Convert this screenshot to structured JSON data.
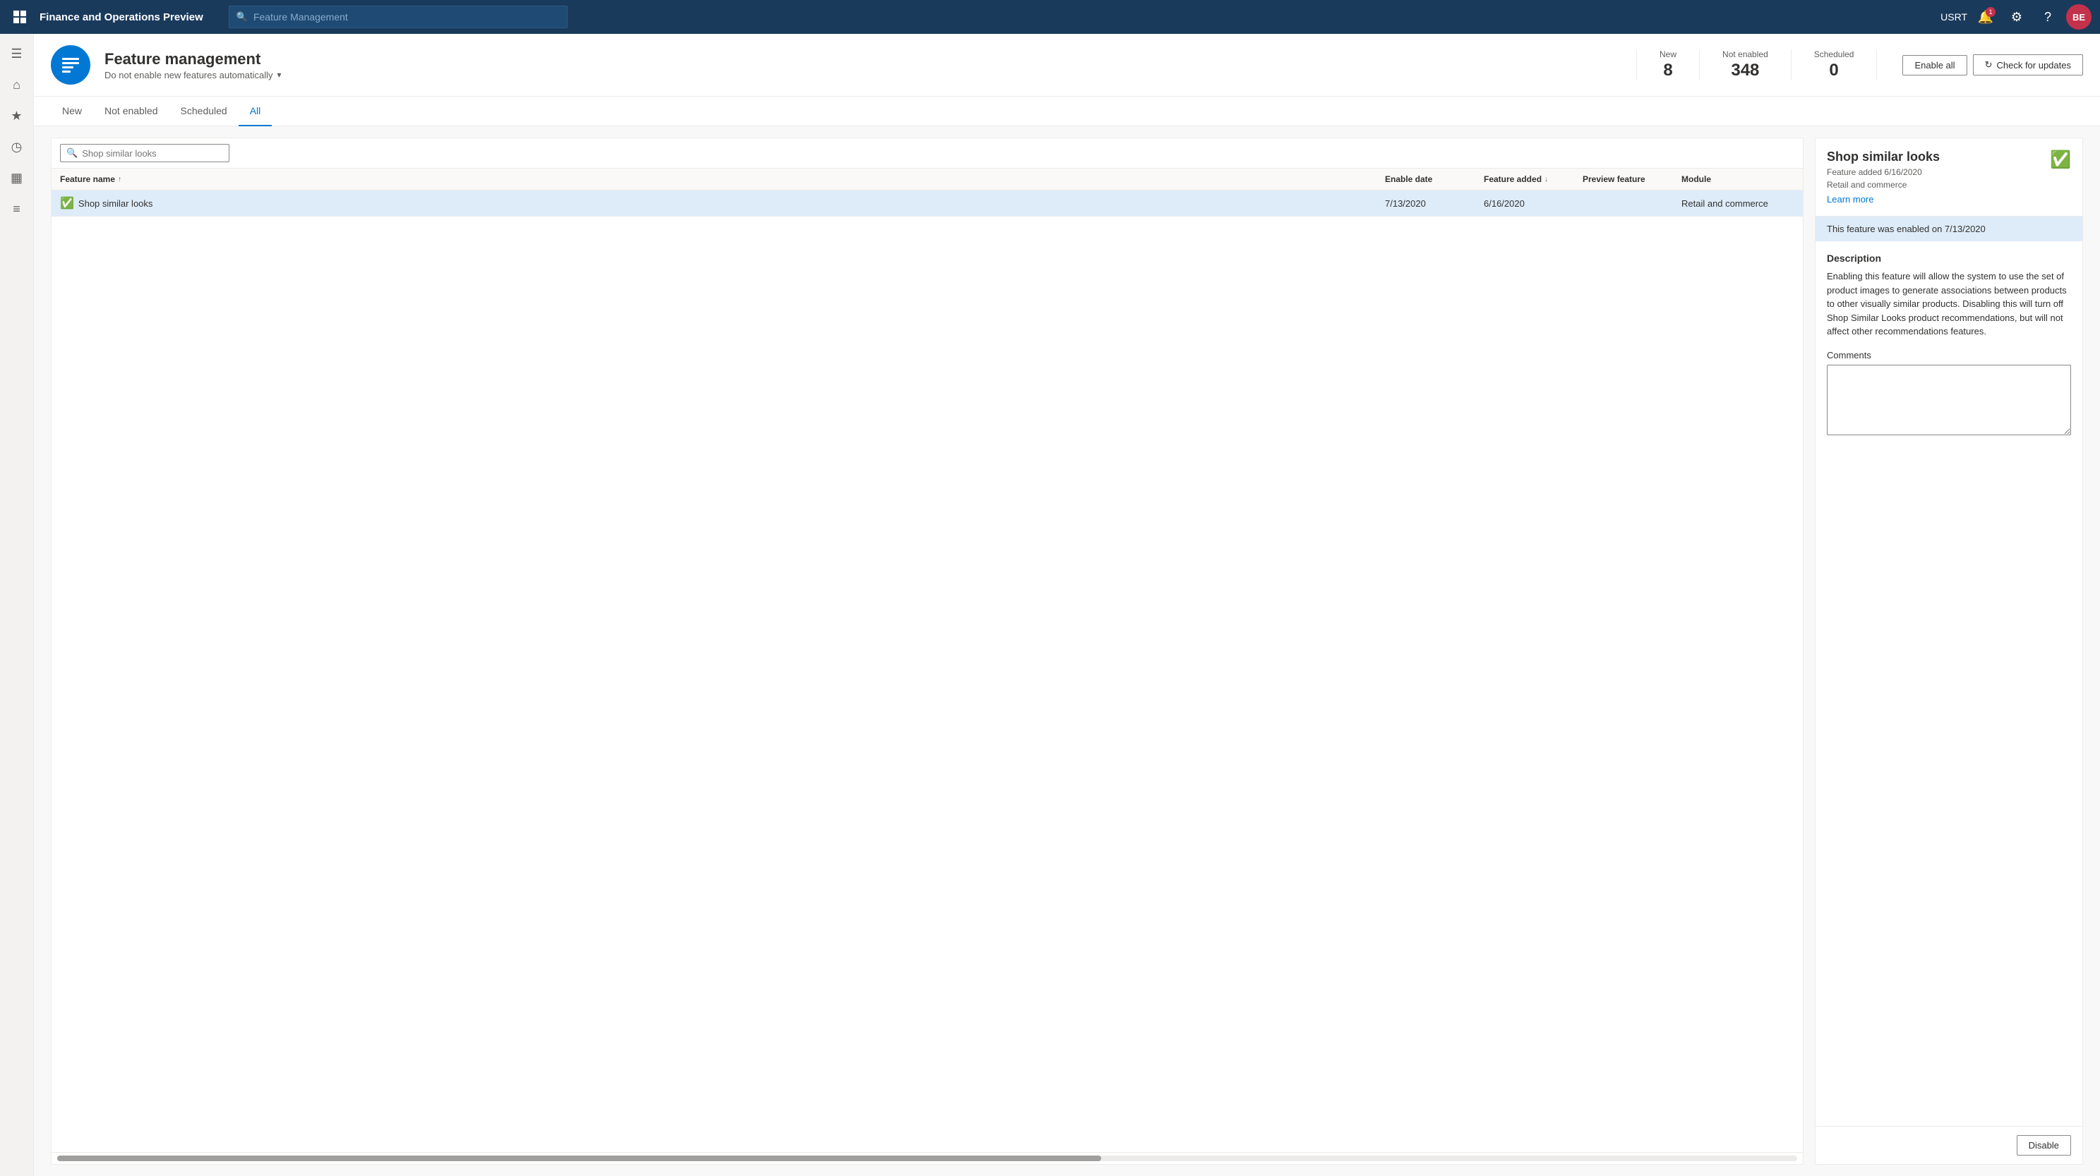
{
  "app": {
    "title": "Finance and Operations Preview",
    "search_placeholder": "Feature Management"
  },
  "topnav": {
    "user": "USRT",
    "avatar": "BE",
    "notification_count": "1"
  },
  "page": {
    "icon_unicode": "☰",
    "title": "Feature management",
    "subtitle": "Do not enable new features automatically",
    "stats": [
      {
        "label": "New",
        "value": "8"
      },
      {
        "label": "Not enabled",
        "value": "348"
      },
      {
        "label": "Scheduled",
        "value": "0"
      }
    ],
    "enable_all_label": "Enable all",
    "check_updates_label": "Check for updates"
  },
  "tabs": [
    {
      "label": "New",
      "active": false
    },
    {
      "label": "Not enabled",
      "active": false
    },
    {
      "label": "Scheduled",
      "active": false
    },
    {
      "label": "All",
      "active": true
    }
  ],
  "table": {
    "search_placeholder": "Shop similar looks",
    "columns": [
      {
        "label": "Feature name",
        "sort": "asc"
      },
      {
        "label": "Enable date",
        "sort": null
      },
      {
        "label": "Feature added",
        "sort": "desc"
      },
      {
        "label": "Preview feature",
        "sort": null
      },
      {
        "label": "Module",
        "sort": null
      }
    ],
    "rows": [
      {
        "name": "Shop similar looks",
        "enabled": true,
        "enable_date": "7/13/2020",
        "feature_added": "6/16/2020",
        "preview_feature": "",
        "module": "Retail and commerce",
        "selected": true
      }
    ]
  },
  "detail": {
    "title": "Shop similar looks",
    "feature_added": "Feature added 6/16/2020",
    "module": "Retail and commerce",
    "learn_more_label": "Learn more",
    "enabled_banner": "This feature was enabled on 7/13/2020",
    "description_title": "Description",
    "description": "Enabling this feature will allow the system to use the set of product images to generate associations between products to other visually similar products. Disabling this will turn off Shop Similar Looks product recommendations, but will not affect other recommendations features.",
    "comments_label": "Comments",
    "comments_placeholder": "",
    "disable_label": "Disable"
  },
  "sidebar_items": [
    {
      "icon": "☰",
      "name": "menu"
    },
    {
      "icon": "⌂",
      "name": "home"
    },
    {
      "icon": "★",
      "name": "favorites"
    },
    {
      "icon": "◷",
      "name": "recent"
    },
    {
      "icon": "▦",
      "name": "workspaces"
    },
    {
      "icon": "≡",
      "name": "modules"
    }
  ]
}
